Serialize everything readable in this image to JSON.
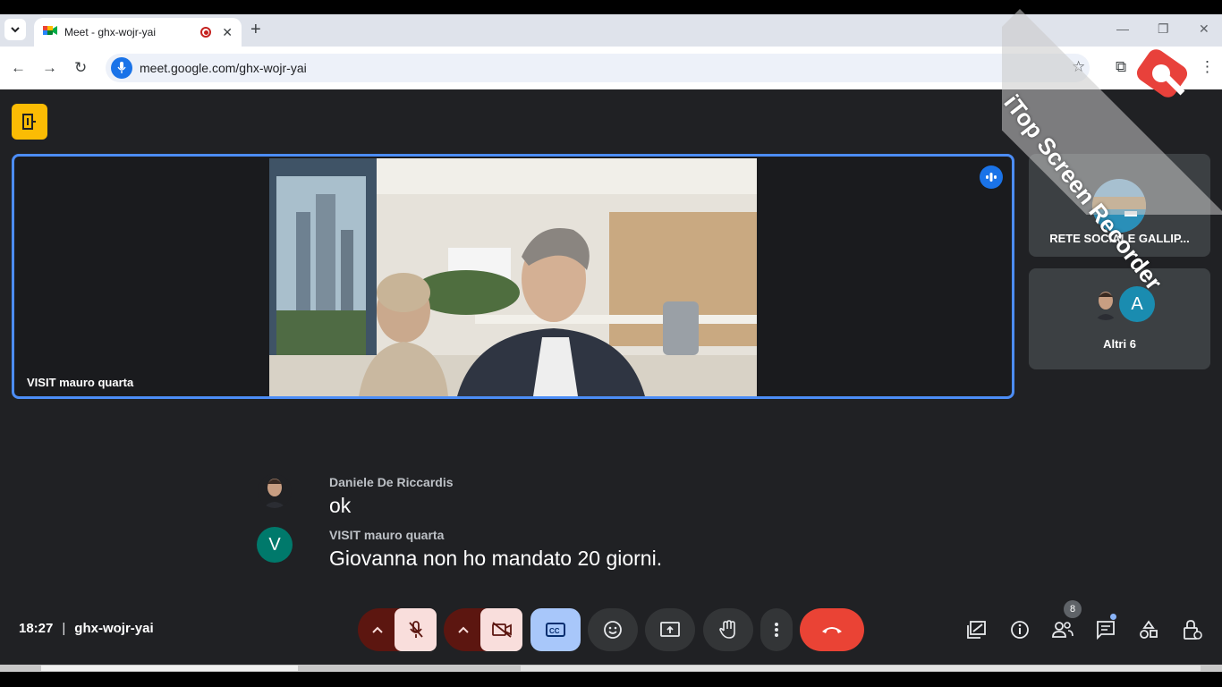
{
  "browser": {
    "tab_title": "Meet - ghx-wojr-yai",
    "url": "meet.google.com/ghx-wojr-yai"
  },
  "meet": {
    "main_tile_name": "VISIT mauro quarta",
    "side_tiles": [
      {
        "name": "RETE SOCIALE GALLIP..."
      },
      {
        "name": "Altri 6",
        "avatar_letter": "A"
      }
    ],
    "captions": [
      {
        "speaker": "Daniele De Riccardis",
        "text": "ok"
      },
      {
        "speaker": "VISIT mauro quarta",
        "avatar_letter": "V",
        "text": "Giovanna non ho mandato 20 giorni."
      }
    ],
    "time": "18:27",
    "separator": "|",
    "meeting_code": "ghx-wojr-yai",
    "participants_count": "8"
  },
  "watermark": {
    "text": "iTop Screen Recorder"
  },
  "colors": {
    "meet_bg": "#202124",
    "active_border": "#4c8df6",
    "end_call": "#ea4335",
    "muted_dark": "#5c1610",
    "muted_light": "#f9dedc",
    "captions_active": "#a8c7fa",
    "activity_icon": "#fbbc04"
  },
  "icons": [
    "tab-search-icon",
    "meet-favicon",
    "record-icon",
    "close-icon",
    "new-tab-icon",
    "back-icon",
    "forward-icon",
    "reload-icon",
    "mic-icon",
    "star-icon",
    "extensions-icon",
    "menu-icon",
    "activities-icon",
    "speaking-icon",
    "chevron-up-icon",
    "mic-off-icon",
    "camera-off-icon",
    "captions-icon",
    "emoji-icon",
    "present-icon",
    "hand-icon",
    "more-icon",
    "end-call-icon",
    "companion-icon",
    "info-icon",
    "people-icon",
    "chat-icon",
    "shapes-icon",
    "host-controls-icon"
  ]
}
